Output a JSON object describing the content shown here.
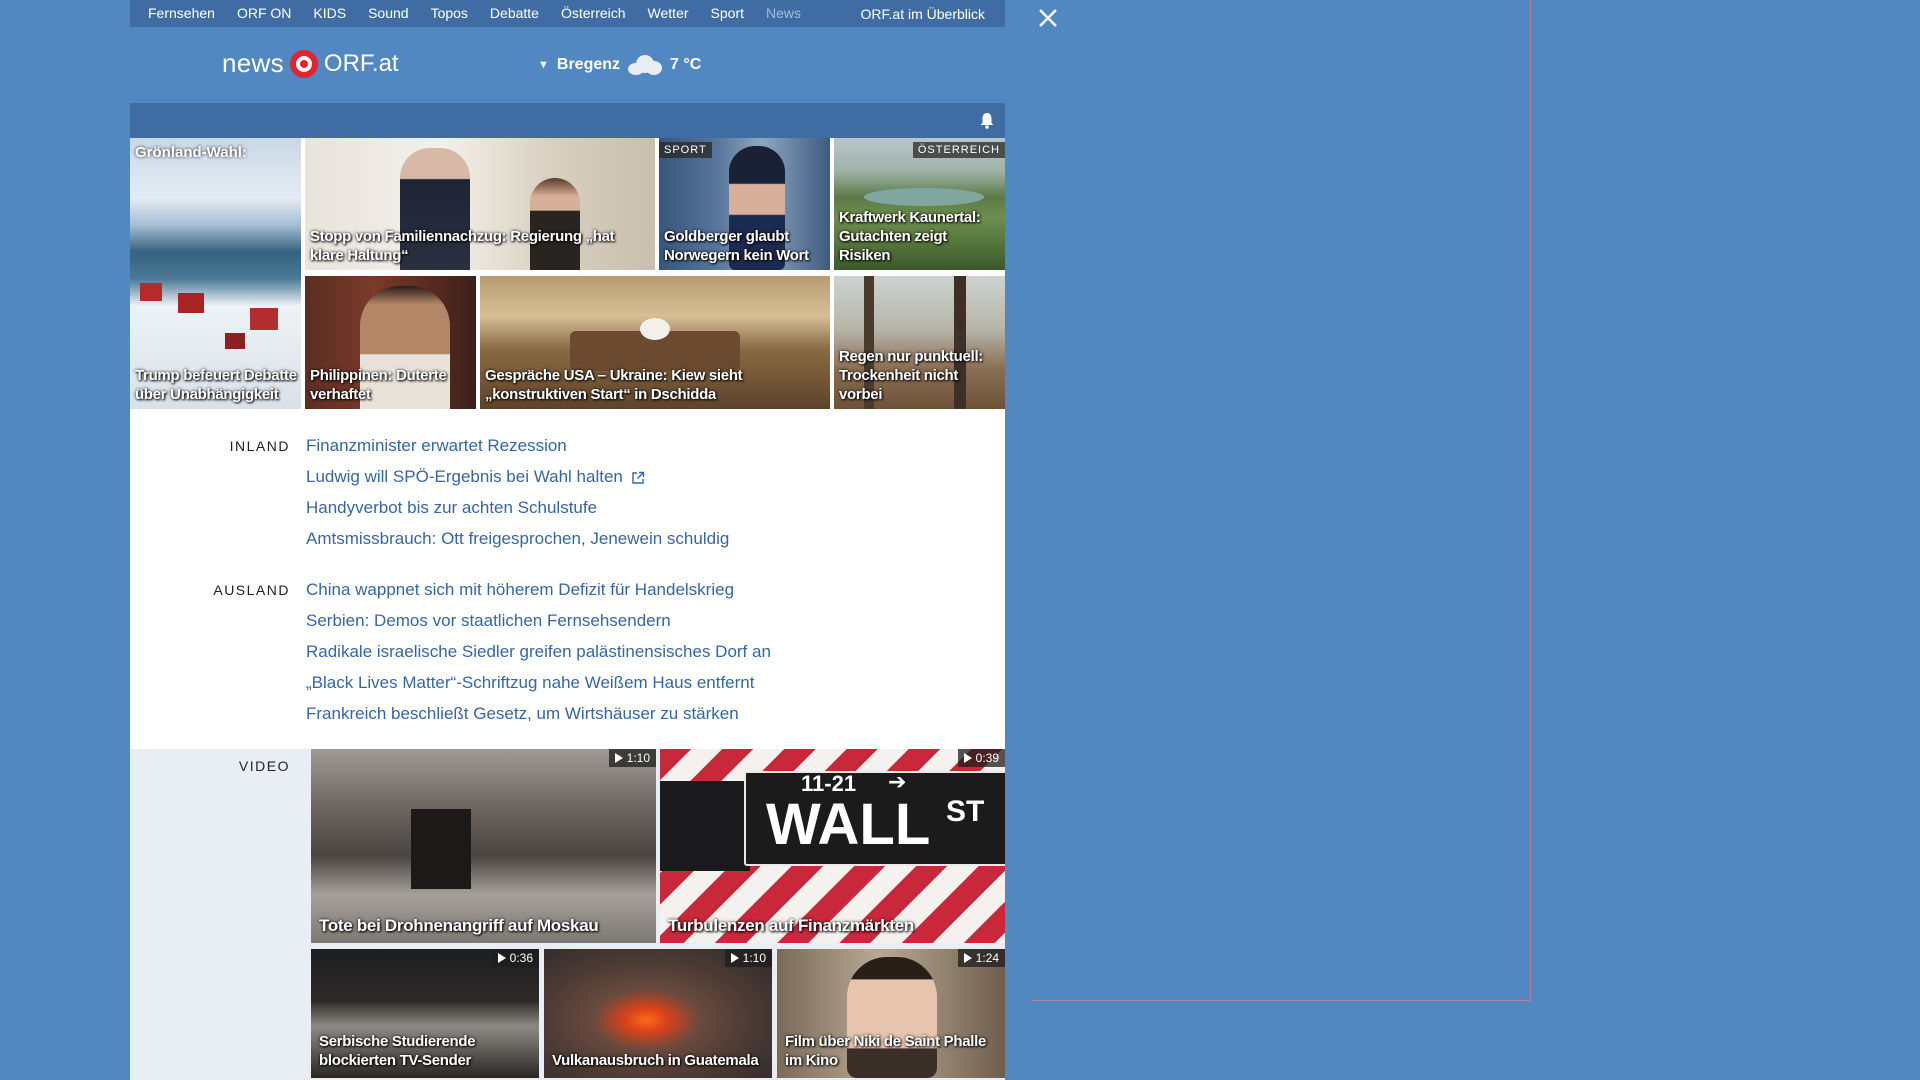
{
  "nav": {
    "items": [
      "Fernsehen",
      "ORF ON",
      "KIDS",
      "Sound",
      "Topos",
      "Debatte",
      "Österreich",
      "Wetter",
      "Sport",
      "News"
    ],
    "overview": "ORF.at im Überblick"
  },
  "logo": {
    "news": "news",
    "brand": "ORF.at"
  },
  "weather": {
    "location": "Bregenz",
    "temp": "7 °C",
    "icon": "cloud-icon"
  },
  "tiles": {
    "t1": {
      "caption_top": "Grönland-Wahl:",
      "caption": "Trump befeuert Debatte über Unabhängigkeit"
    },
    "t2": {
      "caption": "Stopp von Familiennachzug: Regierung „hat klare Haltung“"
    },
    "t3": {
      "tag": "SPORT",
      "caption": "Goldberger glaubt Norwegern kein Wort"
    },
    "t4": {
      "tag": "ÖSTERREICH",
      "caption": "Kraftwerk Kaunertal: Gutachten zeigt Risiken"
    },
    "t5": {
      "caption": "Philippinen: Duterte verhaftet"
    },
    "t6": {
      "caption": "Gespräche USA – Ukraine: Kiew sieht „konstruktiven Start“ in Dschidda"
    },
    "t7": {
      "caption": "Regen nur punktuell: Trockenheit nicht vorbei"
    }
  },
  "inland": {
    "label": "INLAND",
    "links": [
      "Finanzminister erwartet Rezession",
      "Ludwig will SPÖ-Ergebnis bei Wahl halten",
      "Handyverbot bis zur achten Schulstufe",
      "Amtsmissbrauch: Ott freigesprochen, Jenewein schuldig"
    ]
  },
  "ausland": {
    "label": "AUSLAND",
    "links": [
      "China wappnet sich mit höherem Defizit für Handelskrieg",
      "Serbien: Demos vor staatlichen Fernsehsendern",
      "Radikale israelische Siedler greifen palästinensisches Dorf an",
      "„Black Lives Matter“-Schriftzug nahe Weißem Haus entfernt",
      "Frankreich beschließt Gesetz, um Wirtshäuser zu stärken"
    ]
  },
  "video": {
    "label": "VIDEO",
    "items": [
      {
        "duration": "1:10",
        "caption": "Tote bei Drohnenangriff auf Moskau"
      },
      {
        "duration": "0:39",
        "caption": "Turbulenzen auf Finanzmärkten",
        "sign_top": "11-21",
        "sign_main": "WALL",
        "sign_st": "ST"
      },
      {
        "duration": "0:36",
        "caption": "Serbische Studierende blockierten TV-Sender"
      },
      {
        "duration": "1:10",
        "caption": "Vulkanausbruch in Guatemala"
      },
      {
        "duration": "1:24",
        "caption": "Film über Niki de Saint Phalle im Kino"
      }
    ]
  }
}
